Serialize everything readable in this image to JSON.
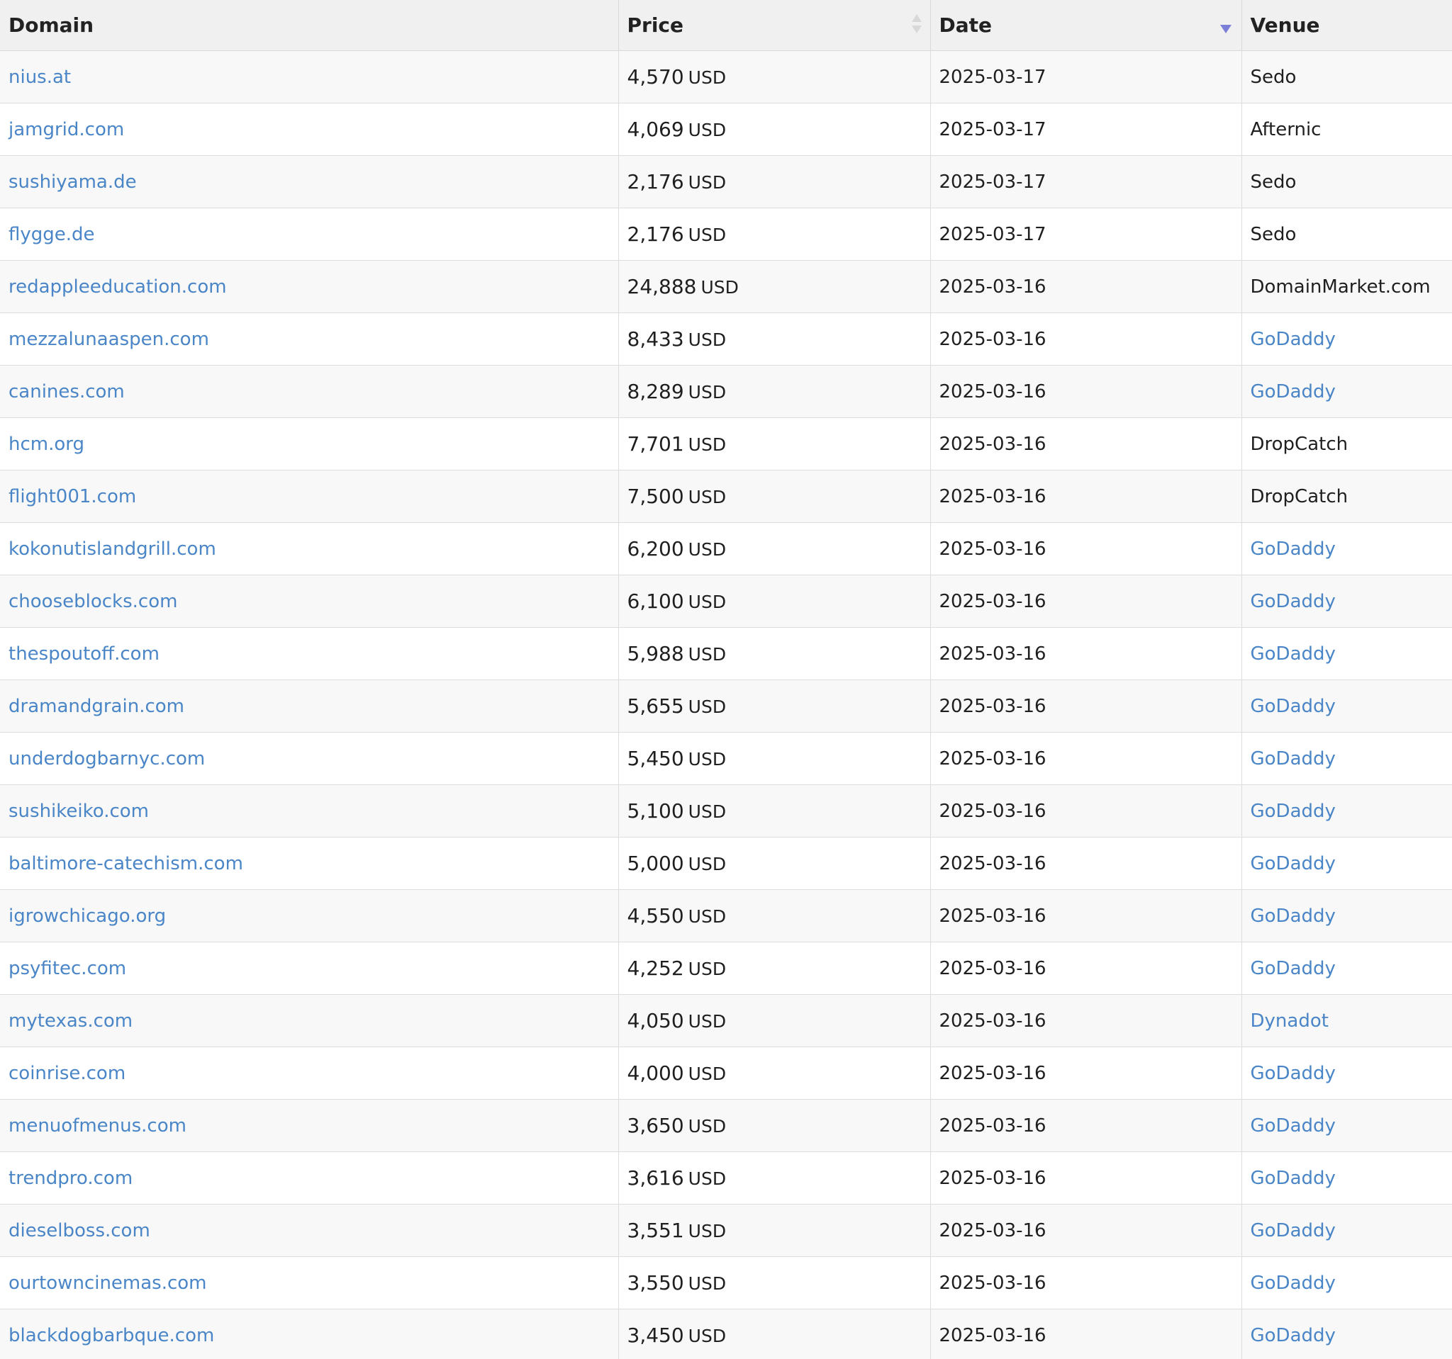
{
  "table": {
    "headers": {
      "domain": "Domain",
      "price": "Price",
      "date": "Date",
      "venue": "Venue"
    },
    "rows": [
      {
        "domain": "nius.at",
        "price": "4,570",
        "currency": "USD",
        "date": "2025-03-17",
        "venue": "Sedo",
        "venue_link": false
      },
      {
        "domain": "jamgrid.com",
        "price": "4,069",
        "currency": "USD",
        "date": "2025-03-17",
        "venue": "Afternic",
        "venue_link": false
      },
      {
        "domain": "sushiyama.de",
        "price": "2,176",
        "currency": "USD",
        "date": "2025-03-17",
        "venue": "Sedo",
        "venue_link": false
      },
      {
        "domain": "flygge.de",
        "price": "2,176",
        "currency": "USD",
        "date": "2025-03-17",
        "venue": "Sedo",
        "venue_link": false
      },
      {
        "domain": "redappleeducation.com",
        "price": "24,888",
        "currency": "USD",
        "date": "2025-03-16",
        "venue": "DomainMarket.com",
        "venue_link": false
      },
      {
        "domain": "mezzalunaaspen.com",
        "price": "8,433",
        "currency": "USD",
        "date": "2025-03-16",
        "venue": "GoDaddy",
        "venue_link": true
      },
      {
        "domain": "canines.com",
        "price": "8,289",
        "currency": "USD",
        "date": "2025-03-16",
        "venue": "GoDaddy",
        "venue_link": true
      },
      {
        "domain": "hcm.org",
        "price": "7,701",
        "currency": "USD",
        "date": "2025-03-16",
        "venue": "DropCatch",
        "venue_link": false
      },
      {
        "domain": "flight001.com",
        "price": "7,500",
        "currency": "USD",
        "date": "2025-03-16",
        "venue": "DropCatch",
        "venue_link": false
      },
      {
        "domain": "kokonutislandgrill.com",
        "price": "6,200",
        "currency": "USD",
        "date": "2025-03-16",
        "venue": "GoDaddy",
        "venue_link": true
      },
      {
        "domain": "chooseblocks.com",
        "price": "6,100",
        "currency": "USD",
        "date": "2025-03-16",
        "venue": "GoDaddy",
        "venue_link": true
      },
      {
        "domain": "thespoutoff.com",
        "price": "5,988",
        "currency": "USD",
        "date": "2025-03-16",
        "venue": "GoDaddy",
        "venue_link": true
      },
      {
        "domain": "dramandgrain.com",
        "price": "5,655",
        "currency": "USD",
        "date": "2025-03-16",
        "venue": "GoDaddy",
        "venue_link": true
      },
      {
        "domain": "underdogbarnyc.com",
        "price": "5,450",
        "currency": "USD",
        "date": "2025-03-16",
        "venue": "GoDaddy",
        "venue_link": true
      },
      {
        "domain": "sushikeiko.com",
        "price": "5,100",
        "currency": "USD",
        "date": "2025-03-16",
        "venue": "GoDaddy",
        "venue_link": true
      },
      {
        "domain": "baltimore-catechism.com",
        "price": "5,000",
        "currency": "USD",
        "date": "2025-03-16",
        "venue": "GoDaddy",
        "venue_link": true
      },
      {
        "domain": "igrowchicago.org",
        "price": "4,550",
        "currency": "USD",
        "date": "2025-03-16",
        "venue": "GoDaddy",
        "venue_link": true
      },
      {
        "domain": "psyfitec.com",
        "price": "4,252",
        "currency": "USD",
        "date": "2025-03-16",
        "venue": "GoDaddy",
        "venue_link": true
      },
      {
        "domain": "mytexas.com",
        "price": "4,050",
        "currency": "USD",
        "date": "2025-03-16",
        "venue": "Dynadot",
        "venue_link": true
      },
      {
        "domain": "coinrise.com",
        "price": "4,000",
        "currency": "USD",
        "date": "2025-03-16",
        "venue": "GoDaddy",
        "venue_link": true
      },
      {
        "domain": "menuofmenus.com",
        "price": "3,650",
        "currency": "USD",
        "date": "2025-03-16",
        "venue": "GoDaddy",
        "venue_link": true
      },
      {
        "domain": "trendpro.com",
        "price": "3,616",
        "currency": "USD",
        "date": "2025-03-16",
        "venue": "GoDaddy",
        "venue_link": true
      },
      {
        "domain": "dieselboss.com",
        "price": "3,551",
        "currency": "USD",
        "date": "2025-03-16",
        "venue": "GoDaddy",
        "venue_link": true
      },
      {
        "domain": "ourtowncinemas.com",
        "price": "3,550",
        "currency": "USD",
        "date": "2025-03-16",
        "venue": "GoDaddy",
        "venue_link": true
      },
      {
        "domain": "blackdogbarbque.com",
        "price": "3,450",
        "currency": "USD",
        "date": "2025-03-16",
        "venue": "GoDaddy",
        "venue_link": true
      }
    ]
  },
  "sort": {
    "price_icon": "sort-both-icon",
    "date_icon": "sort-desc-icon",
    "active_color": "#7b7fd8"
  },
  "colors": {
    "link": "#4a86c7",
    "header_bg": "#f0f0f0",
    "row_alt_bg": "#f8f8f8"
  }
}
